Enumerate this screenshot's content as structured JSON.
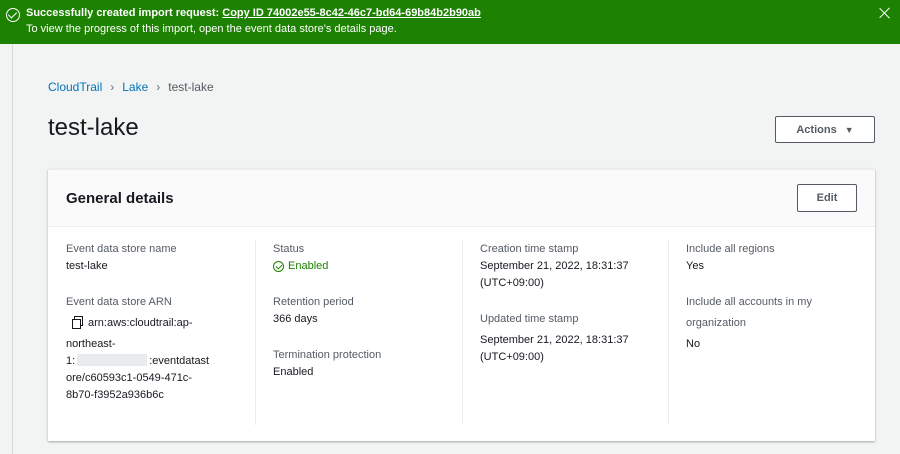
{
  "flash": {
    "title": "Successfully created import request:",
    "link": "Copy ID 74002e55-8c42-46c7-bd64-69b84b2b90ab",
    "message": "To view the progress of this import, open the event data store's details page."
  },
  "breadcrumb": {
    "items": [
      "CloudTrail",
      "Lake"
    ],
    "current": "test-lake"
  },
  "page": {
    "title": "test-lake",
    "actions_label": "Actions"
  },
  "general": {
    "title": "General details",
    "edit_label": "Edit",
    "col1": {
      "name_label": "Event data store name",
      "name_value": "test-lake",
      "arn_label": "Event data store ARN",
      "arn_line1": "arn:aws:cloudtrail:ap-",
      "arn_line2": "northeast-",
      "arn_line3a": "1:",
      "arn_line3b": ":eventdatast",
      "arn_line4": "ore/c60593c1-0549-471c-",
      "arn_line5": "8b70-f3952a936b6c"
    },
    "col2": {
      "status_label": "Status",
      "status_value": "Enabled",
      "retention_label": "Retention period",
      "retention_value": "366 days",
      "termination_label": "Termination protection",
      "termination_value": "Enabled"
    },
    "col3": {
      "created_label": "Creation time stamp",
      "created_value_1": "September 21, 2022, 18:31:37",
      "created_value_2": "(UTC+09:00)",
      "updated_label": "Updated time stamp",
      "updated_value_1": "September 21, 2022, 18:31:37",
      "updated_value_2": "(UTC+09:00)"
    },
    "col4": {
      "regions_label": "Include all regions",
      "regions_value": "Yes",
      "accounts_label_1": "Include all accounts in my",
      "accounts_label_2": "organization",
      "accounts_value": "No"
    }
  },
  "colors": {
    "success": "#1d8102",
    "link": "#0073bb",
    "background": "#f2f3f3"
  }
}
